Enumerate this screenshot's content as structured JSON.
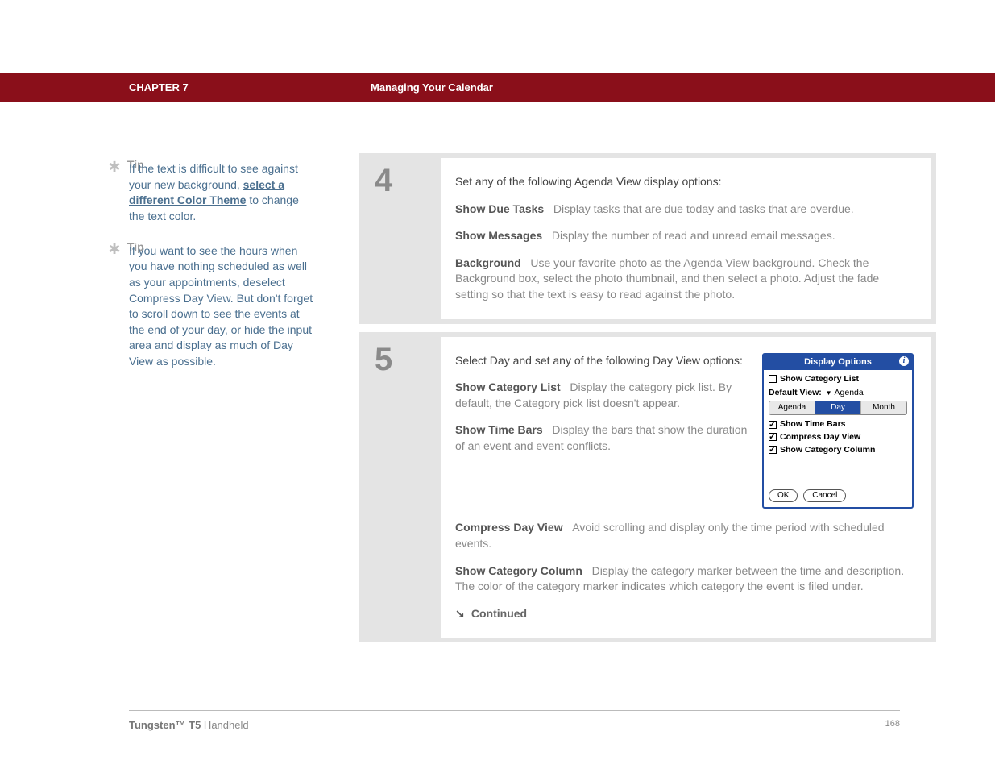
{
  "header": {
    "chapter": "CHAPTER 7",
    "title": "Managing Your Calendar"
  },
  "sidebar": {
    "tips": [
      {
        "label": "Tip",
        "before_link": "If the text is difficult to see against your new background, ",
        "link": "select a different Color Theme",
        "after_link": " to change the text color."
      },
      {
        "label": "Tip",
        "text": "If you want to see the hours when you have nothing scheduled as well as your appointments, deselect Compress Day View. But don't forget to scroll down to see the events at the end of your day, or hide the input area and display as much of Day View as possible."
      }
    ]
  },
  "steps": {
    "s4": {
      "num": "4",
      "intro": "Set any of the following Agenda View display options:",
      "opts": [
        {
          "label": "Show Due Tasks",
          "desc": "Display tasks that are due today and tasks that are overdue."
        },
        {
          "label": "Show Messages",
          "desc": "Display the number of read and unread email messages."
        },
        {
          "label": "Background",
          "desc": "Use your favorite photo as the Agenda View background. Check the Background box, select the photo thumbnail, and then select a photo. Adjust the fade setting so that the text is easy to read against the photo."
        }
      ]
    },
    "s5": {
      "num": "5",
      "intro": "Select Day and set any of the following Day View options:",
      "opts": [
        {
          "label": "Show Category List",
          "desc": "Display the category pick list. By default, the Category pick list doesn't appear."
        },
        {
          "label": "Show Time Bars",
          "desc": "Display the bars that show the duration of an event and event conflicts."
        },
        {
          "label": "Compress Day View",
          "desc": "Avoid scrolling and display only the time period with scheduled events."
        },
        {
          "label": "Show Category Column",
          "desc": "Display the category marker between the time and description. The color of the category marker indicates which category the event is filed under."
        }
      ],
      "continued": "Continued"
    }
  },
  "dialog": {
    "title": "Display Options",
    "show_cat_list": "Show Category List",
    "default_view_label": "Default View:",
    "default_view_value": "Agenda",
    "tabs": {
      "agenda": "Agenda",
      "day": "Day",
      "month": "Month"
    },
    "checks": {
      "time_bars": "Show Time Bars",
      "compress": "Compress Day View",
      "cat_col": "Show Category Column"
    },
    "ok": "OK",
    "cancel": "Cancel"
  },
  "footer": {
    "product_bold": "Tungsten™ T5",
    "product_rest": " Handheld",
    "page": "168"
  }
}
